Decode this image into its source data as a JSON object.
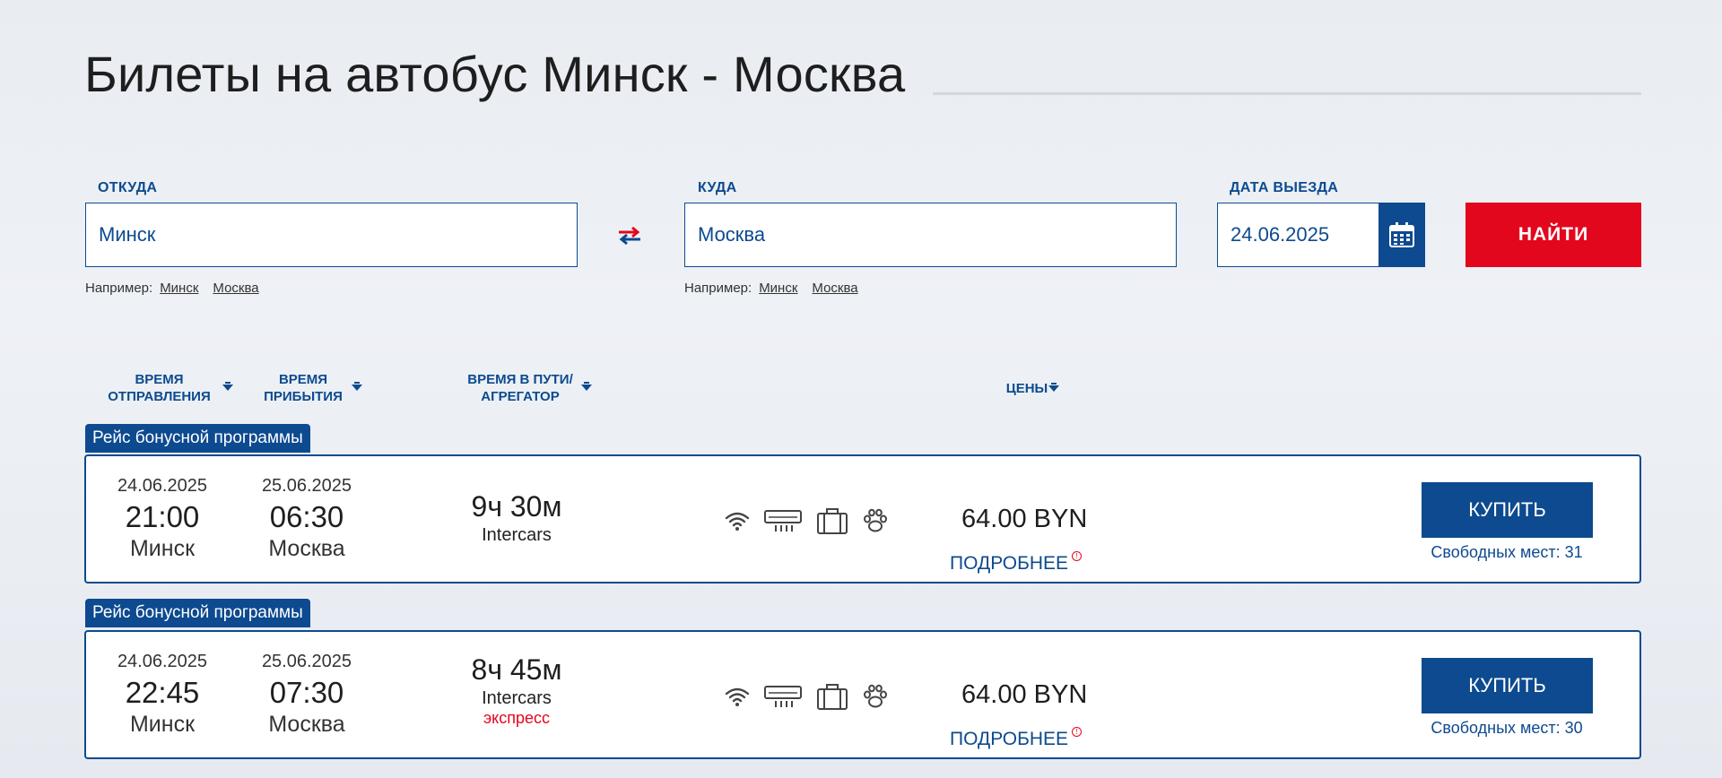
{
  "page": {
    "title": "Билеты на автобус Минск - Москва"
  },
  "search": {
    "from": {
      "label": "ОТКУДА",
      "value": "Минск",
      "examples_label": "Например:",
      "examples": [
        "Минск",
        "Москва"
      ]
    },
    "to": {
      "label": "КУДА",
      "value": "Москва",
      "examples_label": "Например:",
      "examples": [
        "Минск",
        "Москва"
      ]
    },
    "date": {
      "label": "ДАТА ВЫЕЗДА",
      "value": "24.06.2025"
    },
    "find_label": "НАЙТИ"
  },
  "sort": {
    "departure": [
      "ВРЕМЯ",
      "ОТПРАВЛЕНИЯ"
    ],
    "arrival": [
      "ВРЕМЯ",
      "ПРИБЫТИЯ"
    ],
    "duration": [
      "ВРЕМЯ В ПУТИ/",
      "АГРЕГАТОР"
    ],
    "prices": "ЦЕНЫ"
  },
  "trips": [
    {
      "tag": "Рейс бонусной программы",
      "dep_date": "24.06.2025",
      "dep_time": "21:00",
      "dep_city": "Минск",
      "arr_date": "25.06.2025",
      "arr_time": "06:30",
      "arr_city": "Москва",
      "duration": "9ч 30м",
      "carrier": "Intercars",
      "note": "",
      "amenities": [
        "wifi-icon",
        "air-conditioner-icon",
        "luggage-icon",
        "pet-paw-icon"
      ],
      "price": "64.00 BYN",
      "more_label": "ПОДРОБНЕЕ",
      "buy_label": "КУПИТЬ",
      "seats": "Свободных мест: 31"
    },
    {
      "tag": "Рейс бонусной программы",
      "dep_date": "24.06.2025",
      "dep_time": "22:45",
      "dep_city": "Минск",
      "arr_date": "25.06.2025",
      "arr_time": "07:30",
      "arr_city": "Москва",
      "duration": "8ч 45м",
      "carrier": "Intercars",
      "note": "экспресс",
      "amenities": [
        "wifi-icon",
        "air-conditioner-icon",
        "luggage-icon",
        "pet-paw-icon"
      ],
      "price": "64.00 BYN",
      "more_label": "ПОДРОБНЕЕ",
      "buy_label": "КУПИТЬ",
      "seats": "Свободных мест: 30"
    }
  ],
  "colors": {
    "brand_blue": "#0d4a8f",
    "accent_red": "#e3071d"
  }
}
